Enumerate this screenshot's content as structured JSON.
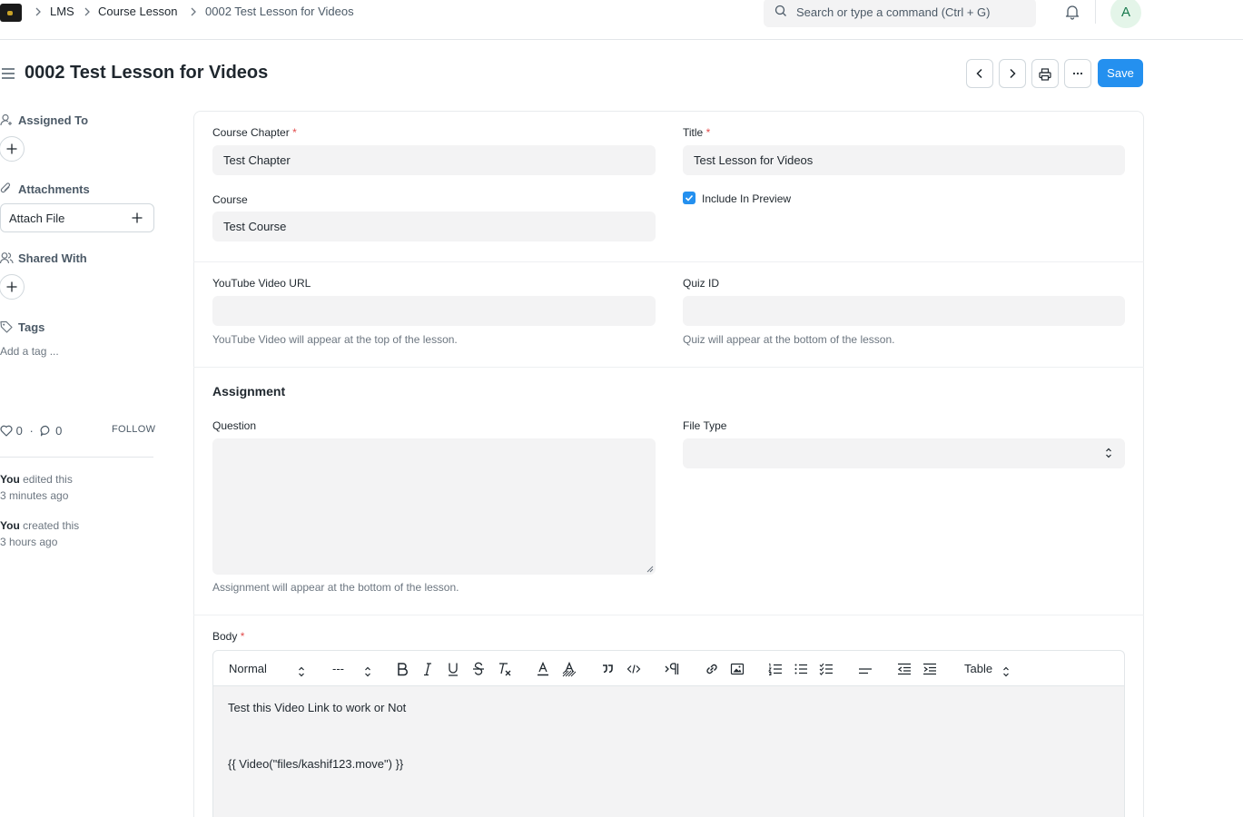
{
  "navbar": {
    "breadcrumbs": [
      "LMS",
      "Course Lesson",
      "0002 Test Lesson for Videos"
    ],
    "search_placeholder": "Search or type a command (Ctrl + G)",
    "avatar_initial": "A"
  },
  "header": {
    "title": "0002 Test Lesson for Videos",
    "save_label": "Save"
  },
  "sidebar": {
    "assigned_to": "Assigned To",
    "attachments": "Attachments",
    "attach_file": "Attach File",
    "shared_with": "Shared With",
    "tags": "Tags",
    "add_tag": "Add a tag ...",
    "likes": "0",
    "comments": "0",
    "follow": "FOLLOW",
    "activity": [
      {
        "who": "You",
        "action": "edited this",
        "when": "3 minutes ago"
      },
      {
        "who": "You",
        "action": "created this",
        "when": "3 hours ago"
      }
    ]
  },
  "form": {
    "course_chapter": {
      "label": "Course Chapter",
      "value": "Test Chapter"
    },
    "title": {
      "label": "Title",
      "value": "Test Lesson for Videos"
    },
    "course": {
      "label": "Course",
      "value": "Test Course"
    },
    "include_in_preview": {
      "label": "Include In Preview",
      "checked": true
    },
    "youtube": {
      "label": "YouTube Video URL",
      "value": "",
      "help": "YouTube Video will appear at the top of the lesson."
    },
    "quiz_id": {
      "label": "Quiz ID",
      "value": "",
      "help": "Quiz will appear at the bottom of the lesson."
    },
    "assignment_section": "Assignment",
    "question": {
      "label": "Question",
      "value": "",
      "help": "Assignment will appear at the bottom of the lesson."
    },
    "file_type": {
      "label": "File Type",
      "value": ""
    },
    "body": {
      "label": "Body",
      "toolbar": {
        "paragraph_style": "Normal",
        "font_size": "---",
        "table": "Table"
      },
      "lines": [
        "Test this Video Link to work or Not",
        "{{ Video(\"files/kashif123.move\") }}"
      ]
    }
  },
  "colors": {
    "primary": "#2490ef",
    "required": "#e24c4c",
    "field_bg": "#f3f3f4"
  }
}
